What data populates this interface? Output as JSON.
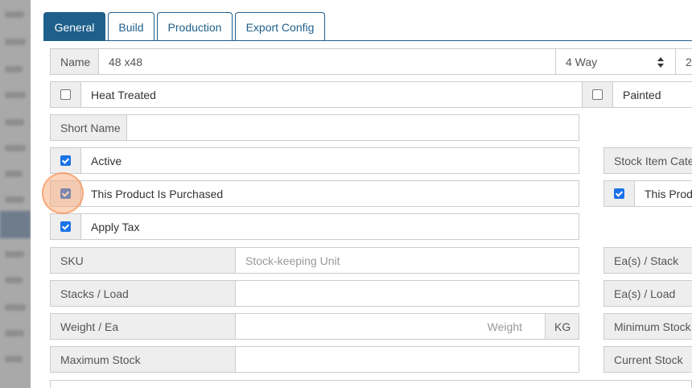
{
  "tabs": [
    {
      "label": "General",
      "active": true
    },
    {
      "label": "Build",
      "active": false
    },
    {
      "label": "Production",
      "active": false
    },
    {
      "label": "Export Config",
      "active": false
    }
  ],
  "form": {
    "name": {
      "label": "Name",
      "value": "48 x48",
      "way_select": "4 Way",
      "extra_select_partial": "2"
    },
    "heat_treated": {
      "label": "Heat Treated",
      "checked": false
    },
    "painted": {
      "label": "Painted",
      "checked": false
    },
    "short_name": {
      "label": "Short Name",
      "value": ""
    },
    "active": {
      "label": "Active",
      "checked": true
    },
    "stock_item_category": {
      "label": "Stock Item Categ"
    },
    "purchased": {
      "label": "This Product Is Purchased",
      "checked": true
    },
    "produced": {
      "label": "This Produ",
      "checked": true
    },
    "apply_tax": {
      "label": "Apply Tax",
      "checked": true
    },
    "sku": {
      "label": "SKU",
      "placeholder": "Stock-keeping Unit"
    },
    "ea_stack": {
      "label": "Ea(s) / Stack"
    },
    "stacks_load": {
      "label": "Stacks / Load",
      "value": ""
    },
    "ea_load": {
      "label": "Ea(s) / Load"
    },
    "weight_ea": {
      "label": "Weight / Ea",
      "placeholder": "Weight",
      "unit": "KG"
    },
    "minimum_stock": {
      "label": "Minimum Stock"
    },
    "maximum_stock": {
      "label": "Maximum Stock",
      "value": ""
    },
    "current_stock": {
      "label": "Current Stock"
    }
  },
  "colors": {
    "accent": "#1f5f8b",
    "checkbox": "#1a73e8",
    "highlight": "#f8a064"
  }
}
